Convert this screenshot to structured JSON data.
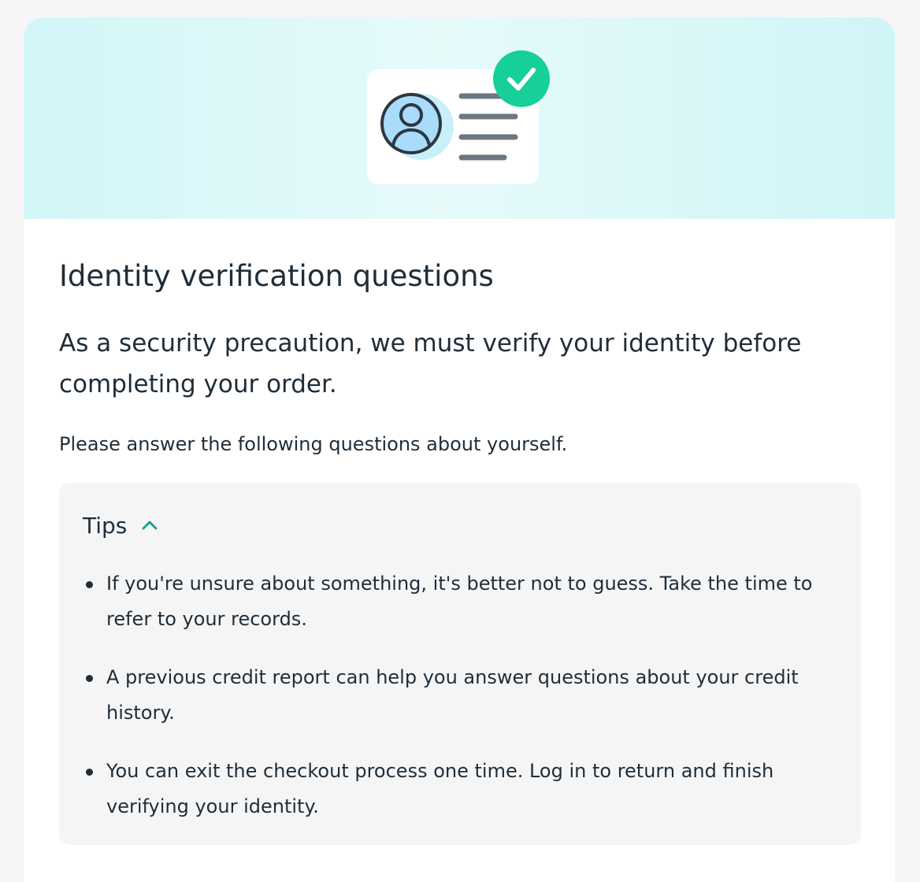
{
  "hero": {
    "illustration_icon": "id-card-verified-icon",
    "colors": {
      "hero_background": "#d6f7f8",
      "check_badge": "#17cf98",
      "avatar_fill": "#a8dcfa",
      "avatar_stroke": "#2d3740",
      "card_lines": "#6b7883"
    }
  },
  "content": {
    "title": "Identity verification questions",
    "lead": "As a security precaution, we must verify your identity before completing your order.",
    "instruction": "Please answer the following questions about yourself."
  },
  "tips": {
    "label": "Tips",
    "toggle_icon": "chevron-up-icon",
    "accent_color": "#1aa38b",
    "expanded": true,
    "items": [
      {
        "text": "If you're unsure about something, it's better not to guess. Take the time to refer to your records."
      },
      {
        "text": "A previous credit report can help you answer questions about your credit history."
      },
      {
        "text": "You can exit the checkout process one time. Log in to return and finish verifying your identity."
      }
    ]
  }
}
